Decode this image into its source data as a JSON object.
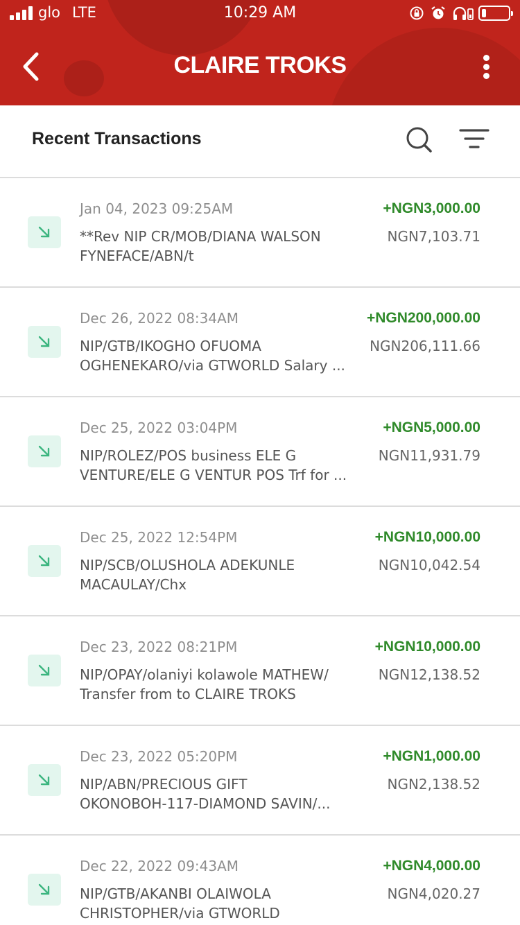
{
  "status_bar": {
    "carrier": "glo",
    "network": "LTE",
    "time": "10:29 AM",
    "icons": [
      "orientation-lock-icon",
      "alarm-icon",
      "headphones-icon",
      "battery-icon"
    ],
    "battery_level_percent": 10
  },
  "header": {
    "title": "CLAIRE TROKS",
    "back_icon": "chevron-left-icon",
    "menu_icon": "more-vertical-icon",
    "background_color": "#c0241c"
  },
  "transactions_bar": {
    "label": "Recent Transactions",
    "search_icon": "search-icon",
    "filter_icon": "filter-icon"
  },
  "colors": {
    "credit_amount": "#2f8a2a",
    "credit_icon_bg": "#e3f6ee",
    "credit_icon_arrow": "#3bb57f"
  },
  "transactions": [
    {
      "date": "Jan 04, 2023 09:25AM",
      "desc_line1": "**Rev NIP CR/MOB/DIANA WALSON",
      "desc_line2": "FYNEFACE/ABN/t",
      "amount": "+NGN3,000.00",
      "balance": "NGN7,103.71"
    },
    {
      "date": "Dec 26, 2022 08:34AM",
      "desc_line1": "NIP/GTB/IKOGHO OFUOMA",
      "desc_line2": "OGHENEKARO/via GTWORLD Salary ...",
      "amount": "+NGN200,000.00",
      "balance": "NGN206,111.66"
    },
    {
      "date": "Dec 25, 2022 03:04PM",
      "desc_line1": "NIP/ROLEZ/POS business ELE G",
      "desc_line2": "VENTURE/ELE G VENTUR POS Trf for ...",
      "amount": "+NGN5,000.00",
      "balance": "NGN11,931.79"
    },
    {
      "date": "Dec 25, 2022 12:54PM",
      "desc_line1": "NIP/SCB/OLUSHOLA ADEKUNLE",
      "desc_line2": "MACAULAY/Chx",
      "amount": "+NGN10,000.00",
      "balance": "NGN10,042.54"
    },
    {
      "date": "Dec 23, 2022 08:21PM",
      "desc_line1": "NIP/OPAY/olaniyi kolawole MATHEW/",
      "desc_line2": "Transfer from to CLAIRE TROKS",
      "amount": "+NGN10,000.00",
      "balance": "NGN12,138.52"
    },
    {
      "date": "Dec 23, 2022 05:20PM",
      "desc_line1": "NIP/ABN/PRECIOUS GIFT",
      "desc_line2": "OKONOBOH-117-DIAMOND SAVIN/...",
      "amount": "+NGN1,000.00",
      "balance": "NGN2,138.52"
    },
    {
      "date": "Dec 22, 2022 09:43AM",
      "desc_line1": "NIP/GTB/AKANBI OLAIWOLA",
      "desc_line2": "CHRISTOPHER/via GTWORLD",
      "amount": "+NGN4,000.00",
      "balance": "NGN4,020.27"
    }
  ]
}
